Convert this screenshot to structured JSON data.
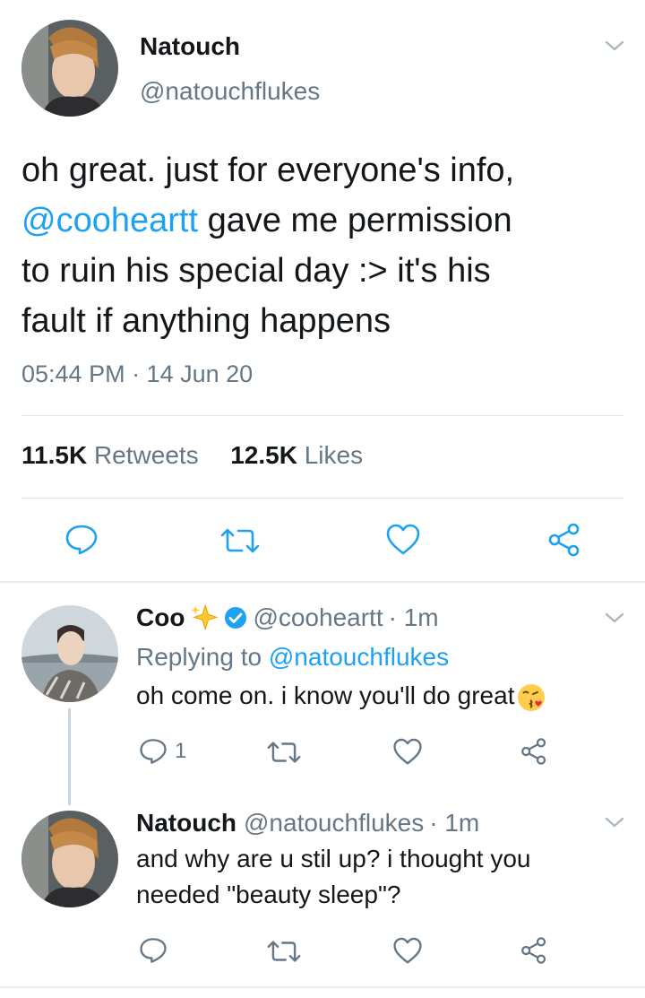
{
  "main_tweet": {
    "author_name": "Natouch",
    "author_handle": "@natouchflukes",
    "text_part1": "oh great. just for everyone's info,",
    "mention": "@cooheartt",
    "text_part2": " gave me permission",
    "text_line3": "to ruin his special day :> it's his",
    "text_line4": "fault if anything happens",
    "timestamp": "05:44 PM · 14 Jun 20",
    "retweets_count": "11.5K",
    "retweets_label": "Retweets",
    "likes_count": "12.5K",
    "likes_label": "Likes"
  },
  "replies": [
    {
      "author_name": "Coo",
      "author_handle": "@cooheartt",
      "time": "· 1m",
      "replying_prefix": "Replying to ",
      "replying_to": "@natouchflukes",
      "text": "oh come on. i know you'll do great",
      "emoji": "kissing-face-emoji",
      "verified": true,
      "reply_count": "1"
    },
    {
      "author_name": "Natouch",
      "author_handle": "@natouchflukes",
      "time": "· 1m",
      "text_line1": "and why are u stil up? i thought you",
      "text_line2": "needed \"beauty sleep\"?"
    }
  ],
  "icons": [
    "chevron-down-icon",
    "reply-icon",
    "retweet-icon",
    "like-icon",
    "share-icon",
    "verified-badge-icon",
    "sparkles-icon"
  ],
  "colors": {
    "accent": "#1da1f2",
    "secondary_text": "#657786",
    "icon": "#657786",
    "divider": "#e1e8ed"
  }
}
